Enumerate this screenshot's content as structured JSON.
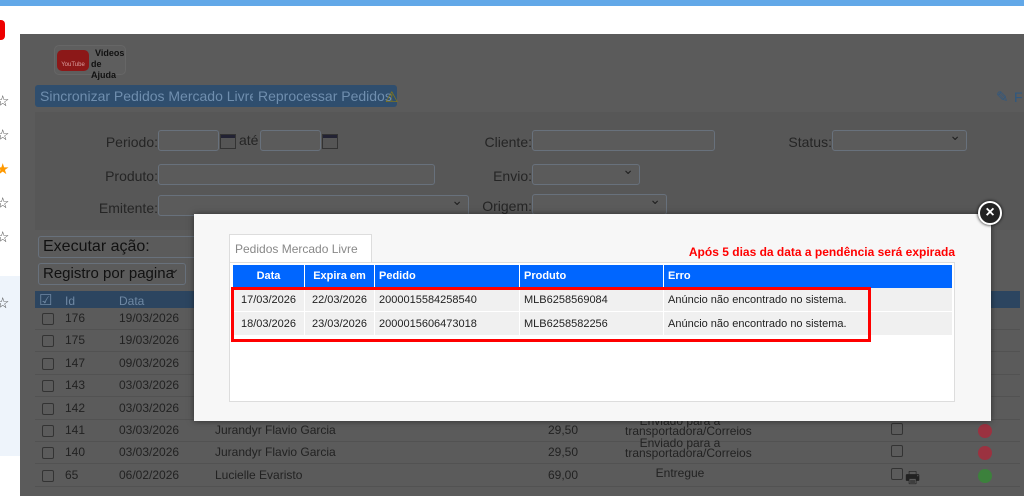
{
  "help_video": {
    "top": "Videos",
    "bottom": "de Ajuda",
    "badge": "YouTube"
  },
  "toolbar": {
    "sync_label": "Sincronizar Pedidos Mercado Livre",
    "reprocess_label": "Reprocessar Pedidos",
    "right_partial": "F"
  },
  "filters": {
    "periodo": "Periodo:",
    "ate": "até",
    "produto": "Produto:",
    "emitente": "Emitente:",
    "cliente": "Cliente:",
    "envio": "Envio:",
    "origem": "Origem:",
    "status": "Status:"
  },
  "actions": {
    "execute": "Executar ação:",
    "per_page": "Registro por pagina"
  },
  "grid": {
    "headers": [
      "Id",
      "Data"
    ],
    "rows": [
      {
        "id": "176",
        "date": "19/03/2026",
        "client": "",
        "value": "",
        "status": "",
        "status_color": ""
      },
      {
        "id": "175",
        "date": "19/03/2026",
        "client": "",
        "value": "",
        "status": "",
        "status_color": ""
      },
      {
        "id": "147",
        "date": "09/03/2026",
        "client": "",
        "value": "",
        "status": "",
        "status_color": ""
      },
      {
        "id": "143",
        "date": "03/03/2026",
        "client": "",
        "value": "",
        "status": "",
        "status_color": ""
      },
      {
        "id": "142",
        "date": "03/03/2026",
        "client": "",
        "value": "",
        "status": "",
        "status_color": ""
      },
      {
        "id": "141",
        "date": "03/03/2026",
        "client": "Jurandyr Flavio Garcia",
        "value": "29,50",
        "status": "Enviado para a transportadora/Correios",
        "status_color": "#d0102a"
      },
      {
        "id": "140",
        "date": "03/03/2026",
        "client": "Jurandyr Flavio Garcia",
        "value": "29,50",
        "status": "Enviado para a transportadora/Correios",
        "status_color": "#d0102a"
      },
      {
        "id": "65",
        "date": "06/02/2026",
        "client": "Lucielle Evaristo",
        "value": "69,00",
        "status": "Entregue",
        "status_color": "#22a022"
      }
    ]
  },
  "modal": {
    "tab": "Pedidos Mercado Livre",
    "notice": "Após 5 dias da data a pendência será expirada",
    "headers": [
      "Data",
      "Expira em",
      "Pedido",
      "Produto",
      "Erro"
    ],
    "rows": [
      [
        "17/03/2026",
        "22/03/2026",
        "2000015584258540",
        "MLB6258569084",
        "Anúncio não encontrado no sistema."
      ],
      [
        "18/03/2026",
        "23/03/2026",
        "2000015606473018",
        "MLB6258582256",
        "Anúncio não encontrado no sistema."
      ]
    ],
    "close": "×"
  }
}
